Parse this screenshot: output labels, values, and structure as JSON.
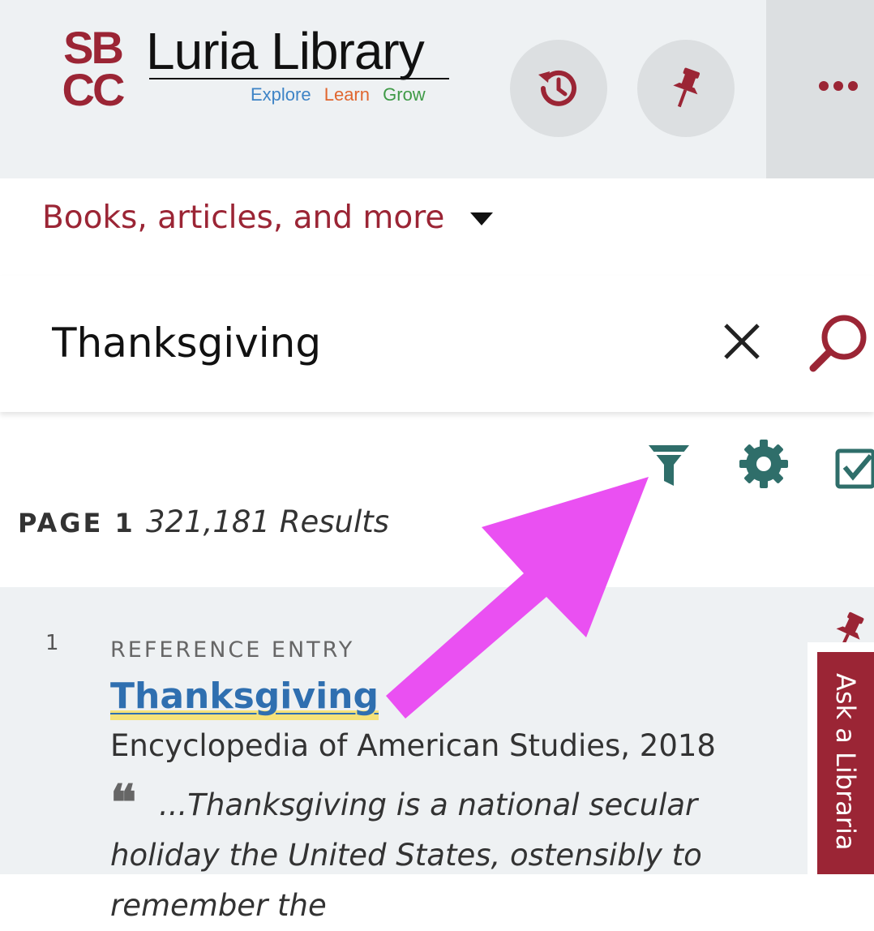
{
  "header": {
    "logo_mark": "SBCC",
    "title": "Luria Library",
    "tagline": [
      {
        "text": "Explore",
        "color": "#3e84c6"
      },
      {
        "text": "Learn",
        "color": "#e0662f"
      },
      {
        "text": "Grow",
        "color": "#3f9a47"
      }
    ],
    "buttons": [
      {
        "name": "history-button",
        "icon": "history-icon"
      },
      {
        "name": "pinned-button",
        "icon": "pin-icon"
      }
    ],
    "more_icon": "more-dots-icon"
  },
  "search": {
    "scope_label": "Books, articles, and more",
    "query": "Thanksgiving",
    "clear_icon": "close-icon",
    "submit_icon": "search-icon"
  },
  "toolbar": {
    "icons": [
      "filter-icon",
      "gear-icon",
      "checkbox-icon"
    ]
  },
  "results_summary": {
    "page_label": "PAGE 1",
    "count_label": "321,181 Results"
  },
  "results": [
    {
      "number": "1",
      "type": "REFERENCE ENTRY",
      "title": "Thanksgiving",
      "source": "Encyclopedia of American Studies, 2018",
      "snippet": "...Thanksgiving is a national secular holiday the United States, ostensibly to remember the"
    }
  ],
  "ask_tab": {
    "label": "Ask a Libraria"
  },
  "colors": {
    "brand": "#9b2535",
    "teal": "#2f6e6a",
    "link": "#2f6fb0",
    "highlight": "#f5e27a",
    "annotation": "#ea50f2"
  }
}
